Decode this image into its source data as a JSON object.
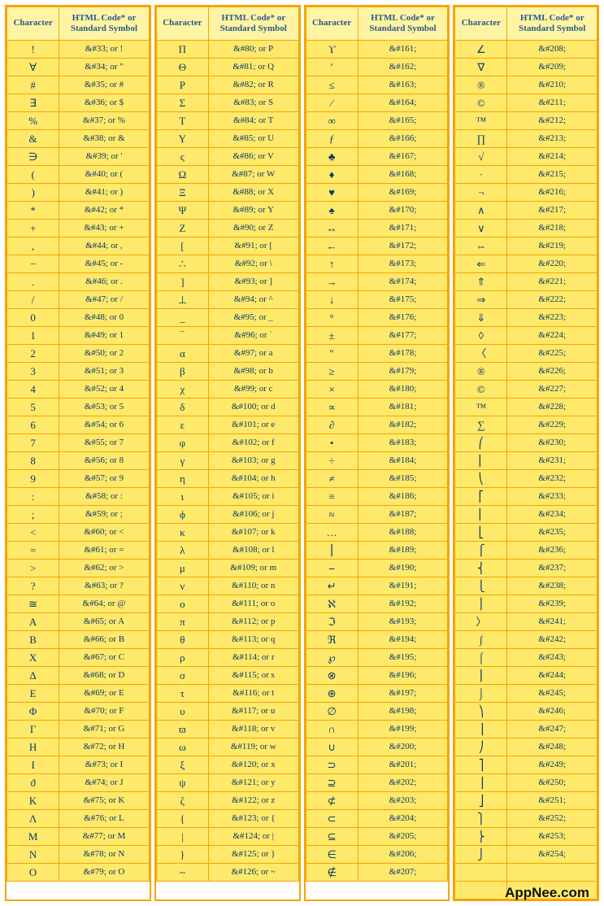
{
  "headers": {
    "char": "Character",
    "code": "HTML Code* or Standard Symbol"
  },
  "columns": [
    [
      {
        "char": "!",
        "code": "&#33; or !"
      },
      {
        "char": "∀",
        "code": "&#34; or \""
      },
      {
        "char": "#",
        "code": "&#35; or #"
      },
      {
        "char": "∃",
        "code": "&#36; or $"
      },
      {
        "char": "%",
        "code": "&#37; or %"
      },
      {
        "char": "&",
        "code": "&#38; or &"
      },
      {
        "char": "∋",
        "code": "&#39; or '"
      },
      {
        "char": "(",
        "code": "&#40; or ("
      },
      {
        "char": ")",
        "code": "&#41; or )"
      },
      {
        "char": "*",
        "code": "&#42; or *"
      },
      {
        "char": "+",
        "code": "&#43; or +"
      },
      {
        "char": ",",
        "code": "&#44; or ,"
      },
      {
        "char": "−",
        "code": "&#45; or -"
      },
      {
        "char": ".",
        "code": "&#46; or ."
      },
      {
        "char": "/",
        "code": "&#47; or /"
      },
      {
        "char": "0",
        "code": "&#48; or 0"
      },
      {
        "char": "1",
        "code": "&#49; or 1"
      },
      {
        "char": "2",
        "code": "&#50; or 2"
      },
      {
        "char": "3",
        "code": "&#51; or 3"
      },
      {
        "char": "4",
        "code": "&#52; or 4"
      },
      {
        "char": "5",
        "code": "&#53; or 5"
      },
      {
        "char": "6",
        "code": "&#54; or 6"
      },
      {
        "char": "7",
        "code": "&#55; or 7"
      },
      {
        "char": "8",
        "code": "&#56; or 8"
      },
      {
        "char": "9",
        "code": "&#57; or 9"
      },
      {
        "char": ":",
        "code": "&#58; or :"
      },
      {
        "char": ";",
        "code": "&#59; or ;"
      },
      {
        "char": "<",
        "code": "&#60; or <"
      },
      {
        "char": "=",
        "code": "&#61; or ="
      },
      {
        "char": ">",
        "code": "&#62; or >"
      },
      {
        "char": "?",
        "code": "&#63; or ?"
      },
      {
        "char": "≅",
        "code": "&#64; or @"
      },
      {
        "char": "Α",
        "code": "&#65; or A"
      },
      {
        "char": "Β",
        "code": "&#66; or B"
      },
      {
        "char": "Χ",
        "code": "&#67; or C"
      },
      {
        "char": "Δ",
        "code": "&#68; or D"
      },
      {
        "char": "Ε",
        "code": "&#69; or E"
      },
      {
        "char": "Φ",
        "code": "&#70; or F"
      },
      {
        "char": "Γ",
        "code": "&#71; or G"
      },
      {
        "char": "Η",
        "code": "&#72; or H"
      },
      {
        "char": "Ι",
        "code": "&#73; or I"
      },
      {
        "char": "ϑ",
        "code": "&#74; or J"
      },
      {
        "char": "Κ",
        "code": "&#75; or K"
      },
      {
        "char": "Λ",
        "code": "&#76; or L"
      },
      {
        "char": "Μ",
        "code": "&#77; or M"
      },
      {
        "char": "Ν",
        "code": "&#78; or N"
      },
      {
        "char": "Ο",
        "code": "&#79; or O"
      }
    ],
    [
      {
        "char": "Π",
        "code": "&#80; or P"
      },
      {
        "char": "Θ",
        "code": "&#81; or Q"
      },
      {
        "char": "Ρ",
        "code": "&#82; or R"
      },
      {
        "char": "Σ",
        "code": "&#83; or S"
      },
      {
        "char": "Τ",
        "code": "&#84; or T"
      },
      {
        "char": "Υ",
        "code": "&#85; or U"
      },
      {
        "char": "ς",
        "code": "&#86; or V"
      },
      {
        "char": "Ω",
        "code": "&#87; or W"
      },
      {
        "char": "Ξ",
        "code": "&#88; or X"
      },
      {
        "char": "Ψ",
        "code": "&#89; or Y"
      },
      {
        "char": "Ζ",
        "code": "&#90; or Z"
      },
      {
        "char": "[",
        "code": "&#91; or ["
      },
      {
        "char": "∴",
        "code": "&#92; or \\"
      },
      {
        "char": "]",
        "code": "&#93; or ]"
      },
      {
        "char": "⊥",
        "code": "&#94; or ^"
      },
      {
        "char": "_",
        "code": "&#95; or _"
      },
      {
        "char": "‾",
        "code": "&#96; or `"
      },
      {
        "char": "α",
        "code": "&#97; or a"
      },
      {
        "char": "β",
        "code": "&#98; or b"
      },
      {
        "char": "χ",
        "code": "&#99; or c"
      },
      {
        "char": "δ",
        "code": "&#100; or d"
      },
      {
        "char": "ε",
        "code": "&#101; or e"
      },
      {
        "char": "φ",
        "code": "&#102; or f"
      },
      {
        "char": "γ",
        "code": "&#103; or g"
      },
      {
        "char": "η",
        "code": "&#104; or h"
      },
      {
        "char": "ι",
        "code": "&#105; or i"
      },
      {
        "char": "ϕ",
        "code": "&#106; or j"
      },
      {
        "char": "κ",
        "code": "&#107; or k"
      },
      {
        "char": "λ",
        "code": "&#108; or l"
      },
      {
        "char": "μ",
        "code": "&#109; or m"
      },
      {
        "char": "ν",
        "code": "&#110; or n"
      },
      {
        "char": "ο",
        "code": "&#111; or o"
      },
      {
        "char": "π",
        "code": "&#112; or p"
      },
      {
        "char": "θ",
        "code": "&#113; or q"
      },
      {
        "char": "ρ",
        "code": "&#114; or r"
      },
      {
        "char": "σ",
        "code": "&#115; or s"
      },
      {
        "char": "τ",
        "code": "&#116; or t"
      },
      {
        "char": "υ",
        "code": "&#117; or u"
      },
      {
        "char": "ϖ",
        "code": "&#118; or v"
      },
      {
        "char": "ω",
        "code": "&#119; or w"
      },
      {
        "char": "ξ",
        "code": "&#120; or x"
      },
      {
        "char": "ψ",
        "code": "&#121; or y"
      },
      {
        "char": "ζ",
        "code": "&#122; or z"
      },
      {
        "char": "{",
        "code": "&#123; or {"
      },
      {
        "char": "|",
        "code": "&#124; or |"
      },
      {
        "char": "}",
        "code": "&#125; or }"
      },
      {
        "char": "~",
        "code": "&#126; or ~"
      }
    ],
    [
      {
        "char": "ϒ",
        "code": "&#161;"
      },
      {
        "char": "′",
        "code": "&#162;"
      },
      {
        "char": "≤",
        "code": "&#163;"
      },
      {
        "char": "⁄",
        "code": "&#164;"
      },
      {
        "char": "∞",
        "code": "&#165;"
      },
      {
        "char": "ƒ",
        "code": "&#166;"
      },
      {
        "char": "♣",
        "code": "&#167;"
      },
      {
        "char": "♦",
        "code": "&#168;"
      },
      {
        "char": "♥",
        "code": "&#169;"
      },
      {
        "char": "♠",
        "code": "&#170;"
      },
      {
        "char": "↔",
        "code": "&#171;"
      },
      {
        "char": "←",
        "code": "&#172;"
      },
      {
        "char": "↑",
        "code": "&#173;"
      },
      {
        "char": "→",
        "code": "&#174;"
      },
      {
        "char": "↓",
        "code": "&#175;"
      },
      {
        "char": "°",
        "code": "&#176;"
      },
      {
        "char": "±",
        "code": "&#177;"
      },
      {
        "char": "″",
        "code": "&#178;"
      },
      {
        "char": "≥",
        "code": "&#179;"
      },
      {
        "char": "×",
        "code": "&#180;"
      },
      {
        "char": "∝",
        "code": "&#181;"
      },
      {
        "char": "∂",
        "code": "&#182;"
      },
      {
        "char": "•",
        "code": "&#183;"
      },
      {
        "char": "÷",
        "code": "&#184;"
      },
      {
        "char": "≠",
        "code": "&#185;"
      },
      {
        "char": "≡",
        "code": "&#186;"
      },
      {
        "char": "≈",
        "code": "&#187;"
      },
      {
        "char": "…",
        "code": "&#188;"
      },
      {
        "char": "⎮",
        "code": "&#189;"
      },
      {
        "char": "⎯",
        "code": "&#190;"
      },
      {
        "char": "↵",
        "code": "&#191;"
      },
      {
        "char": "ℵ",
        "code": "&#192;"
      },
      {
        "char": "ℑ",
        "code": "&#193;"
      },
      {
        "char": "ℜ",
        "code": "&#194;"
      },
      {
        "char": "℘",
        "code": "&#195;"
      },
      {
        "char": "⊗",
        "code": "&#196;"
      },
      {
        "char": "⊕",
        "code": "&#197;"
      },
      {
        "char": "∅",
        "code": "&#198;"
      },
      {
        "char": "∩",
        "code": "&#199;"
      },
      {
        "char": "∪",
        "code": "&#200;"
      },
      {
        "char": "⊃",
        "code": "&#201;"
      },
      {
        "char": "⊇",
        "code": "&#202;"
      },
      {
        "char": "⊄",
        "code": "&#203;"
      },
      {
        "char": "⊂",
        "code": "&#204;"
      },
      {
        "char": "⊆",
        "code": "&#205;"
      },
      {
        "char": "∈",
        "code": "&#206;"
      },
      {
        "char": "∉",
        "code": "&#207;"
      }
    ],
    [
      {
        "char": "∠",
        "code": "&#208;"
      },
      {
        "char": "∇",
        "code": "&#209;"
      },
      {
        "char": "®",
        "code": "&#210;"
      },
      {
        "char": "©",
        "code": "&#211;"
      },
      {
        "char": "™",
        "code": "&#212;"
      },
      {
        "char": "∏",
        "code": "&#213;"
      },
      {
        "char": "√",
        "code": "&#214;"
      },
      {
        "char": "·",
        "code": "&#215;"
      },
      {
        "char": "¬",
        "code": "&#216;"
      },
      {
        "char": "∧",
        "code": "&#217;"
      },
      {
        "char": "∨",
        "code": "&#218;"
      },
      {
        "char": "⇔",
        "code": "&#219;"
      },
      {
        "char": "⇐",
        "code": "&#220;"
      },
      {
        "char": "⇑",
        "code": "&#221;"
      },
      {
        "char": "⇒",
        "code": "&#222;"
      },
      {
        "char": "⇓",
        "code": "&#223;"
      },
      {
        "char": "◊",
        "code": "&#224;"
      },
      {
        "char": "〈",
        "code": "&#225;"
      },
      {
        "char": "®",
        "code": "&#226;"
      },
      {
        "char": "©",
        "code": "&#227;"
      },
      {
        "char": "™",
        "code": "&#228;"
      },
      {
        "char": "∑",
        "code": "&#229;"
      },
      {
        "char": "⎛",
        "code": "&#230;"
      },
      {
        "char": "⎜",
        "code": "&#231;"
      },
      {
        "char": "⎝",
        "code": "&#232;"
      },
      {
        "char": "⎡",
        "code": "&#233;"
      },
      {
        "char": "⎢",
        "code": "&#234;"
      },
      {
        "char": "⎣",
        "code": "&#235;"
      },
      {
        "char": "⎧",
        "code": "&#236;"
      },
      {
        "char": "⎨",
        "code": "&#237;"
      },
      {
        "char": "⎩",
        "code": "&#238;"
      },
      {
        "char": "⎪",
        "code": "&#239;"
      },
      {
        "char": "〉",
        "code": "&#241;"
      },
      {
        "char": "∫",
        "code": "&#242;"
      },
      {
        "char": "⌠",
        "code": "&#243;"
      },
      {
        "char": "⎮",
        "code": "&#244;"
      },
      {
        "char": "⌡",
        "code": "&#245;"
      },
      {
        "char": "⎞",
        "code": "&#246;"
      },
      {
        "char": "⎟",
        "code": "&#247;"
      },
      {
        "char": "⎠",
        "code": "&#248;"
      },
      {
        "char": "⎤",
        "code": "&#249;"
      },
      {
        "char": "⎥",
        "code": "&#250;"
      },
      {
        "char": "⎦",
        "code": "&#251;"
      },
      {
        "char": "⎫",
        "code": "&#252;"
      },
      {
        "char": "⎬",
        "code": "&#253;"
      },
      {
        "char": "⎭",
        "code": "&#254;"
      },
      {
        "char": " ",
        "code": " "
      },
      {
        "char": " ",
        "code": " "
      }
    ]
  ],
  "logo": "AppNee.com"
}
